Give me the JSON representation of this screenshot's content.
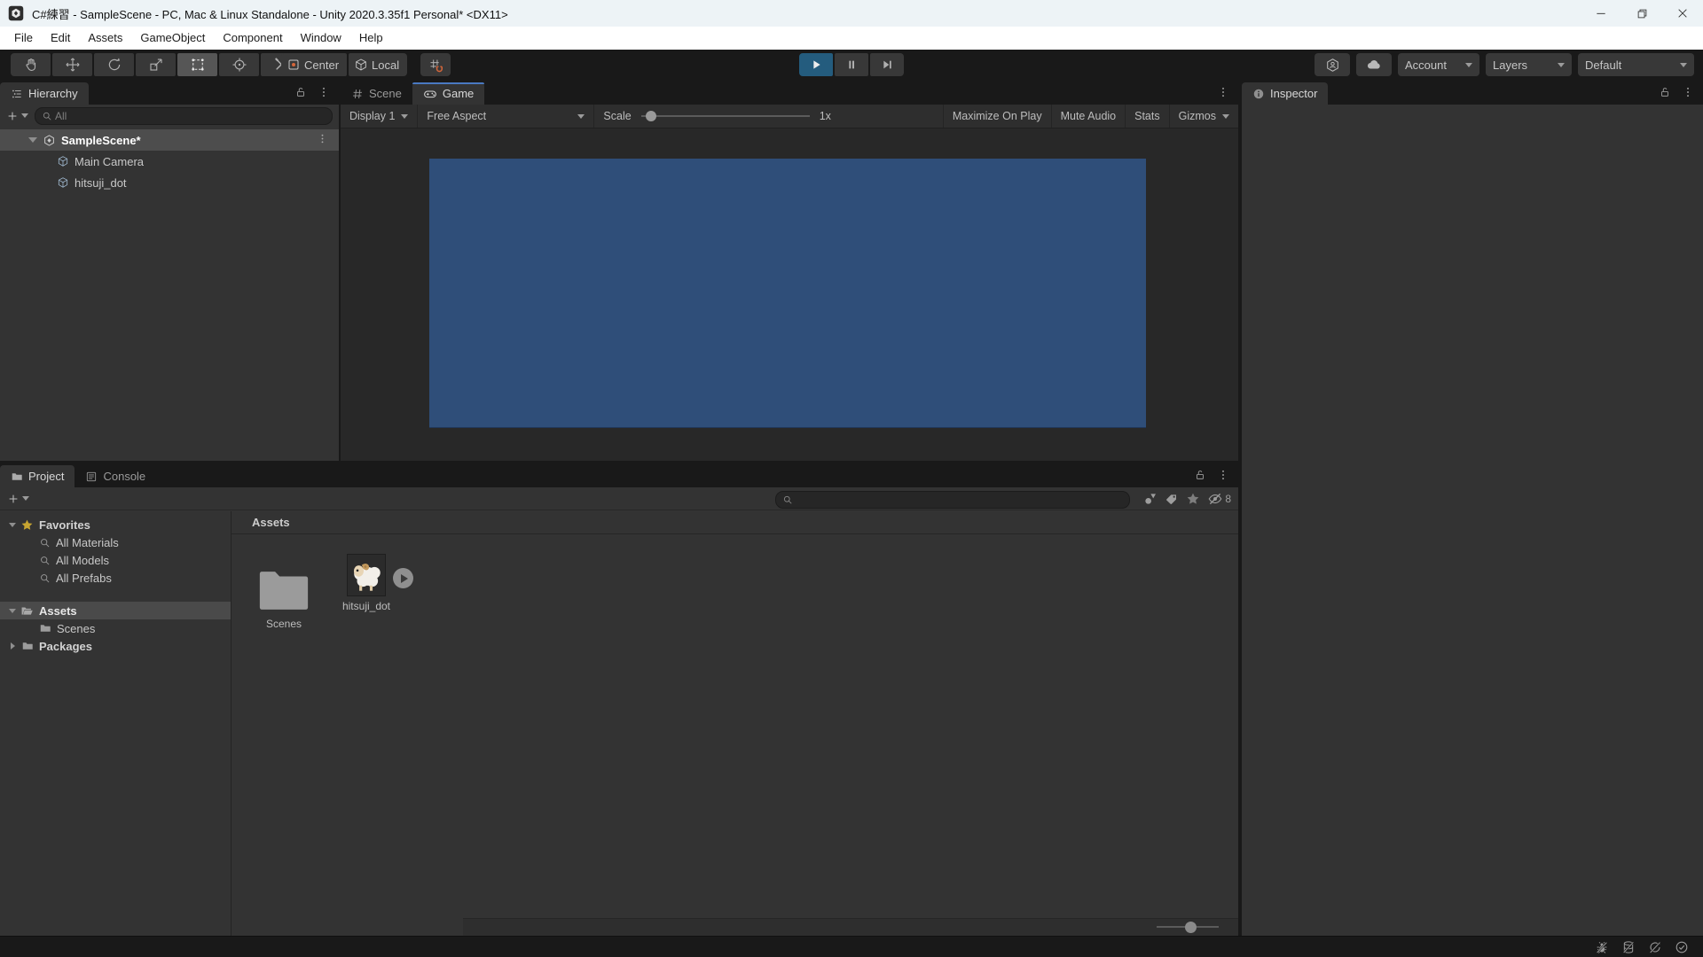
{
  "window": {
    "title": "C#練習 - SampleScene - PC, Mac & Linux Standalone - Unity 2020.3.35f1 Personal* <DX11>"
  },
  "menubar": {
    "items": [
      "File",
      "Edit",
      "Assets",
      "GameObject",
      "Component",
      "Window",
      "Help"
    ]
  },
  "toolbar": {
    "center_label": "Center",
    "local_label": "Local",
    "account_label": "Account",
    "layers_label": "Layers",
    "layout_label": "Default"
  },
  "hierarchy": {
    "tab_label": "Hierarchy",
    "search_placeholder": "All",
    "scene_name": "SampleScene*",
    "children": [
      "Main Camera",
      "hitsuji_dot"
    ]
  },
  "viewport": {
    "scene_tab": "Scene",
    "game_tab": "Game",
    "display": "Display 1",
    "aspect": "Free Aspect",
    "scale_label": "Scale",
    "scale_value": "1x",
    "maximize_label": "Maximize On Play",
    "mute_label": "Mute Audio",
    "stats_label": "Stats",
    "gizmos_label": "Gizmos"
  },
  "inspector": {
    "tab_label": "Inspector"
  },
  "project": {
    "project_tab": "Project",
    "console_tab": "Console",
    "favorites_label": "Favorites",
    "favorite_items": [
      "All Materials",
      "All Models",
      "All Prefabs"
    ],
    "assets_label": "Assets",
    "scenes_label": "Scenes",
    "packages_label": "Packages",
    "header_label": "Assets",
    "items": [
      {
        "name": "Scenes",
        "type": "folder"
      },
      {
        "name": "hitsuji_dot",
        "type": "sprite"
      }
    ],
    "hidden_count": "8"
  },
  "colors": {
    "camera_background": "#2F4E79",
    "play_active": "#245C7E",
    "game_tab_accent": "#4A79C1",
    "favorites_star": "#C7A531",
    "snap_accent": "#D4663A",
    "titlebar_background": "#EDF3F6"
  }
}
